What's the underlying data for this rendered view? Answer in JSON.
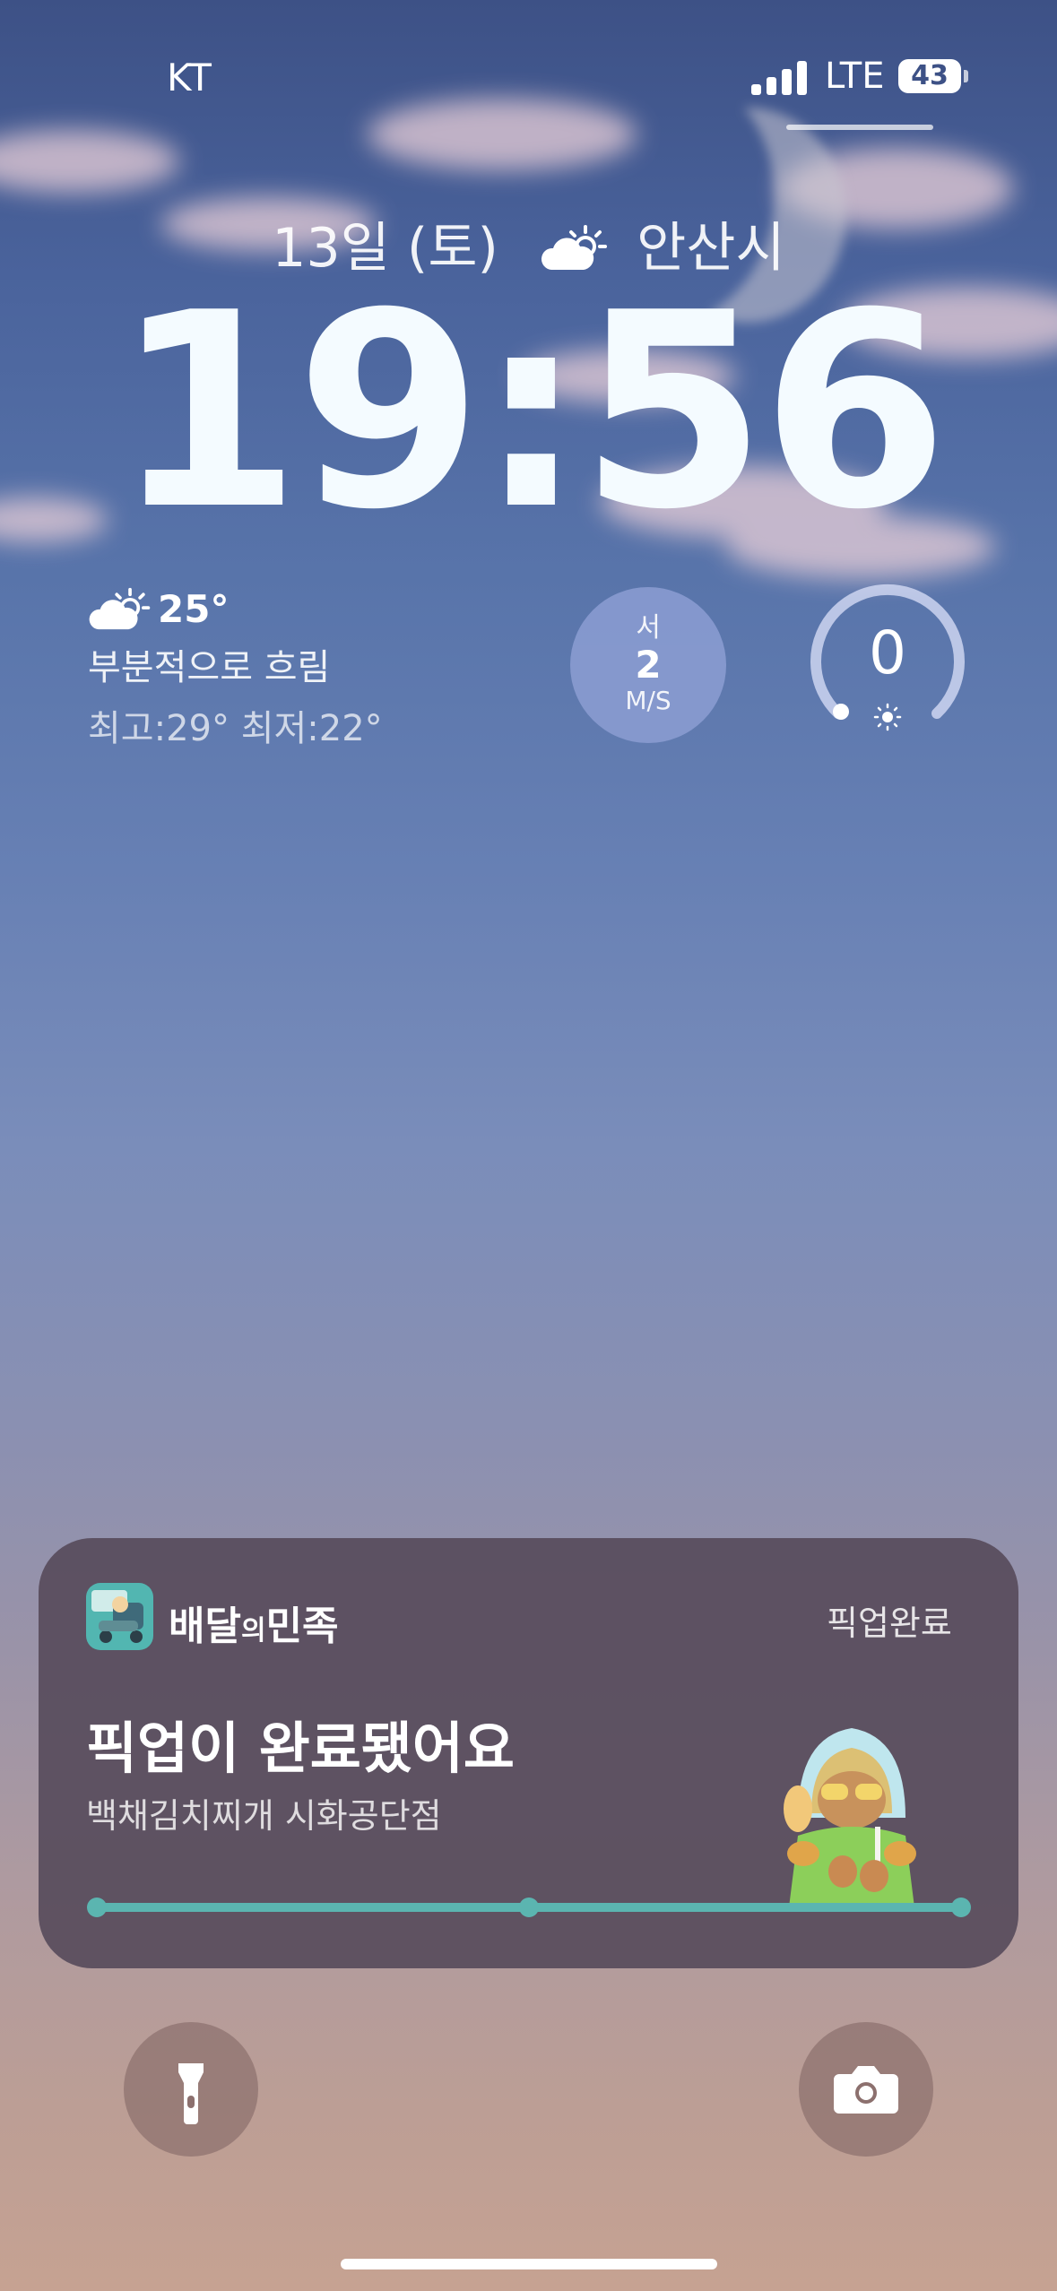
{
  "status_bar": {
    "carrier": "KT",
    "network": "LTE",
    "battery": "43"
  },
  "lock_screen": {
    "date_text": "13일 (토)",
    "location": "안산시",
    "time": "19:56"
  },
  "weather_widget": {
    "icon": "partly-cloudy-icon",
    "temperature": "25°",
    "condition": "부분적으로 흐림",
    "hi_lo": "최고:29° 최저:22°"
  },
  "wind_widget": {
    "direction": "서",
    "speed": "2",
    "unit": "M/S"
  },
  "uv_widget": {
    "value": "0",
    "icon": "sun-icon"
  },
  "notification": {
    "app_name_main": "배달",
    "app_name_small": "의",
    "app_name_end": "민족",
    "status": "픽업완료",
    "title": "픽업이 완료됐어요",
    "subtitle": "백채김치찌개 시화공단점",
    "progress_fraction": 1.0,
    "progress_color": "#5bb5b0"
  },
  "bottom_controls": {
    "left": "flashlight-icon",
    "right": "camera-icon"
  }
}
